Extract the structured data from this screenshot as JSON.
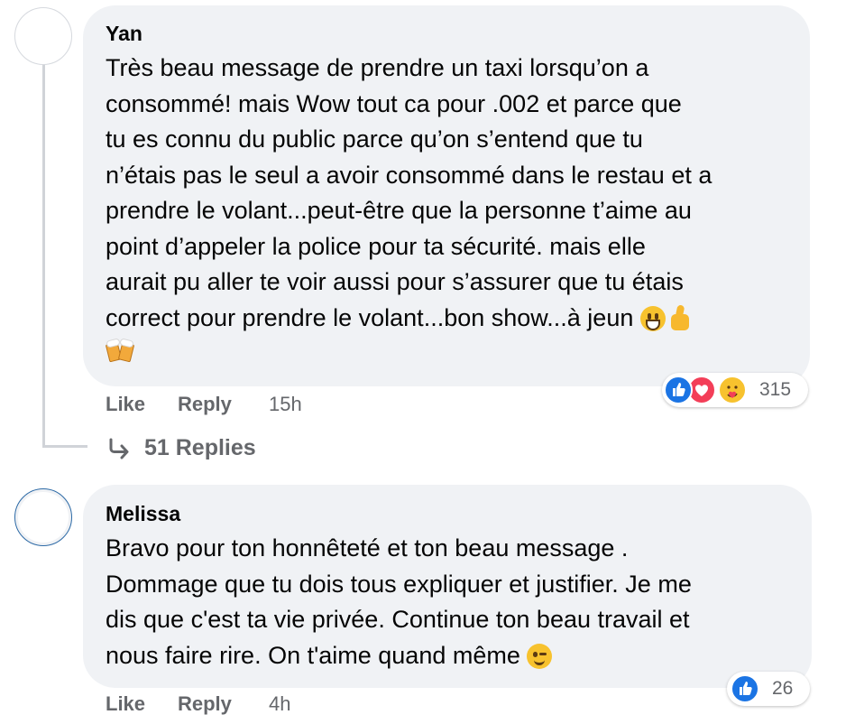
{
  "comments": [
    {
      "author": "Yan",
      "text_lines": [
        "Très beau message de prendre un taxi lorsqu’on a",
        "consommé! mais Wow tout ca pour .002 et parce que",
        "tu es connu du public parce qu’on s’entend que tu",
        "n’étais pas le seul a avoir consommé dans le restau et a",
        "prendre le volant...peut-être que la personne t’aime au",
        "point d’appeler la police pour ta sécurité. mais elle",
        "aurait pu aller te voir aussi pour s’assurer que tu étais",
        "correct pour prendre le volant...bon show...à jeun"
      ],
      "emojis": [
        "grinning-face",
        "thumbs-up",
        "clinking-beer-mugs"
      ],
      "actions": {
        "like": "Like",
        "reply": "Reply",
        "time": "15h"
      },
      "reactions": {
        "types": [
          "like",
          "love",
          "care"
        ],
        "count": "315"
      },
      "replies_label": "51 Replies",
      "replies_icon": "reply-arrow-icon"
    },
    {
      "author": "Melissa",
      "text_lines": [
        "Bravo pour ton honnêteté et ton beau message .",
        "Dommage que tu dois tous expliquer et justifier. Je me",
        "dis que c'est ta vie privée. Continue ton beau travail et",
        "nous faire rire. On t'aime quand même"
      ],
      "emojis": [
        "winking-face"
      ],
      "actions": {
        "like": "Like",
        "reply": "Reply",
        "time": "4h"
      },
      "reactions": {
        "types": [
          "like"
        ],
        "count": "26"
      }
    }
  ],
  "colors": {
    "bubble_bg": "#f0f2f5",
    "secondary_text": "#65676b",
    "like_blue": "#1b74e4",
    "love_red": "#f33e58",
    "care_yellow": "#f7c22e"
  }
}
